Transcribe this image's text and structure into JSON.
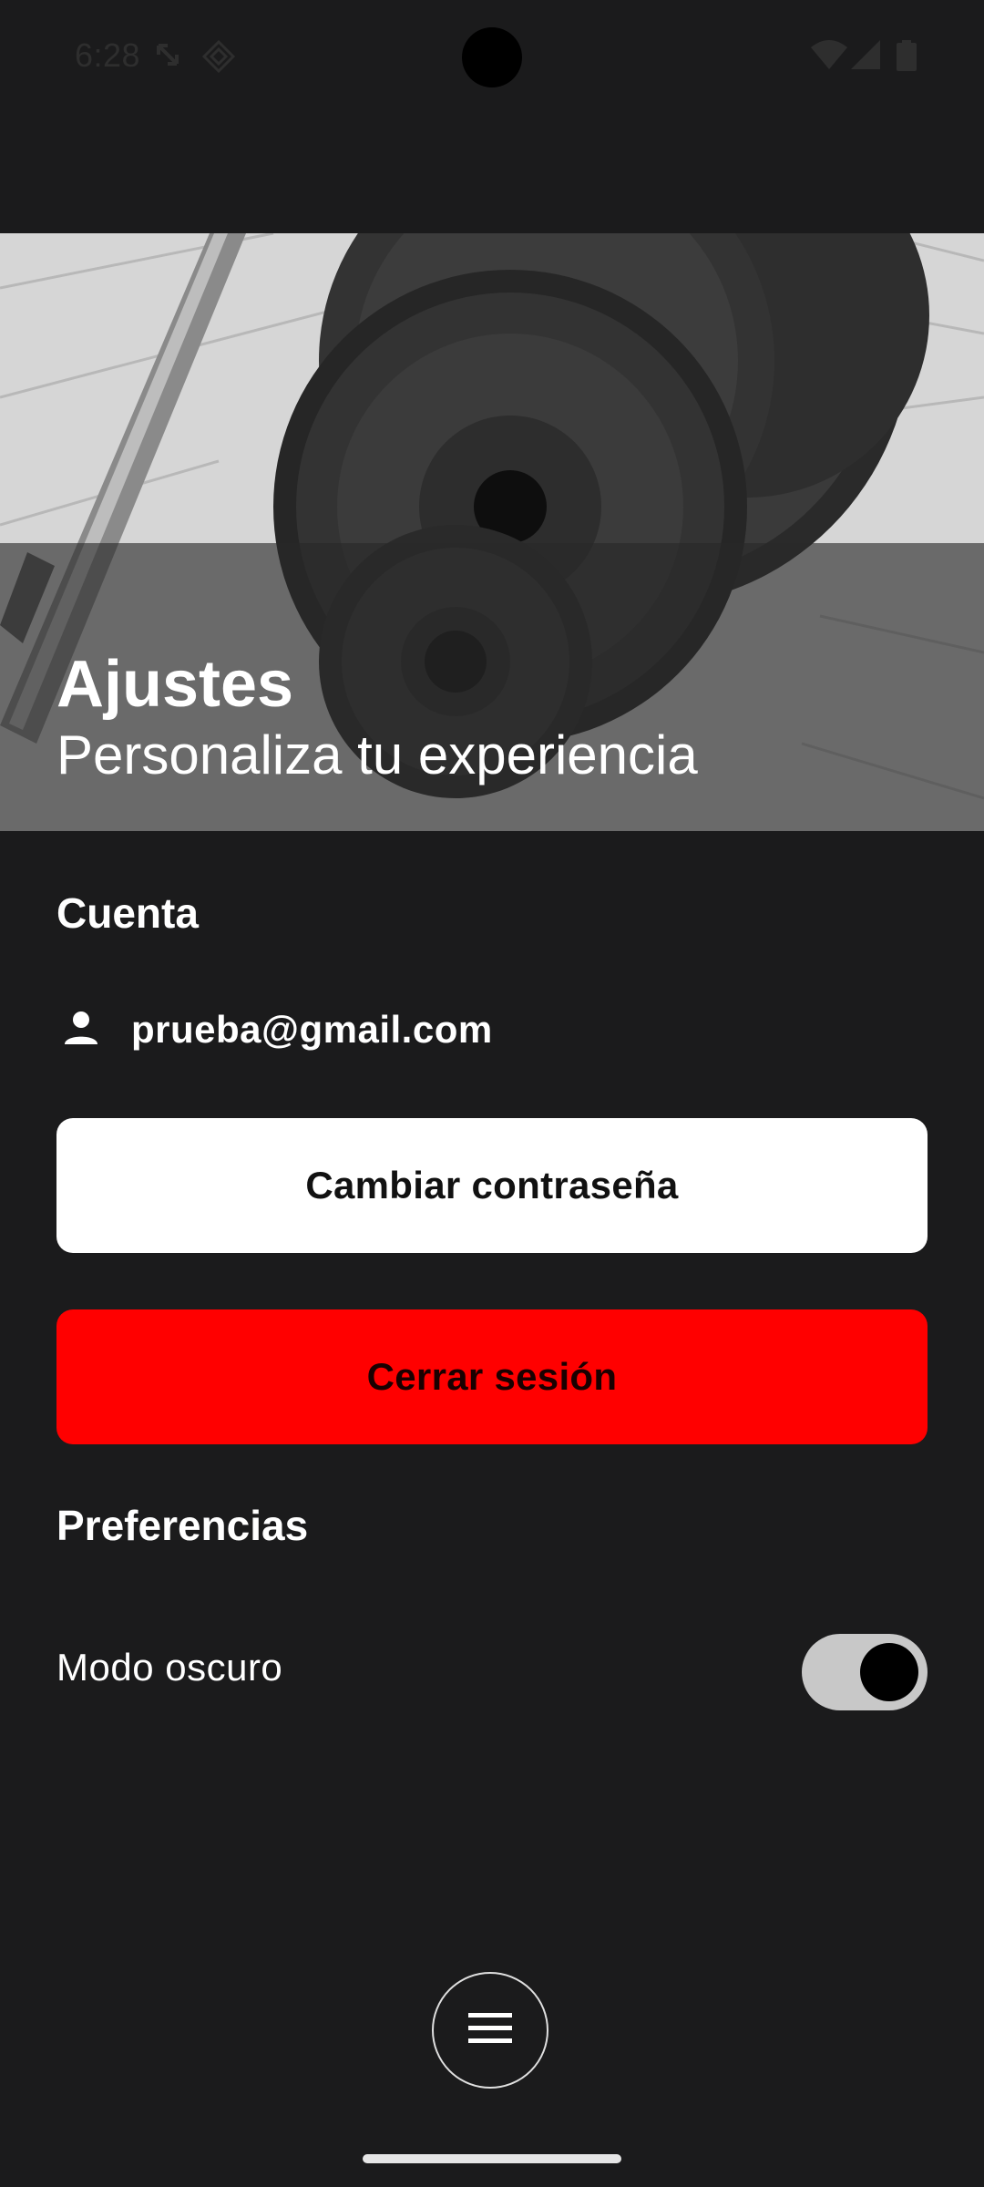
{
  "status_bar": {
    "time": "6:28",
    "icons": [
      "screen-rotate-icon",
      "location-diamond-icon",
      "wifi-icon",
      "signal-icon",
      "battery-icon"
    ]
  },
  "header": {
    "title": "Ajustes",
    "subtitle": "Personaliza tu experiencia",
    "image": "barbell-weight-plates-photo"
  },
  "account": {
    "heading": "Cuenta",
    "email": "prueba@gmail.com",
    "user_icon": "person-icon",
    "change_password_label": "Cambiar contraseña",
    "logout_label": "Cerrar sesión"
  },
  "preferences": {
    "heading": "Preferencias",
    "dark_mode_label": "Modo oscuro",
    "dark_mode_enabled": true
  },
  "navigation": {
    "menu_icon": "hamburger-menu-icon"
  },
  "colors": {
    "background": "#1b1b1c",
    "primary_button": "#ffffff",
    "danger_button": "#ff0000",
    "toggle_track": "#c8c8c8",
    "toggle_knob": "#000000"
  }
}
